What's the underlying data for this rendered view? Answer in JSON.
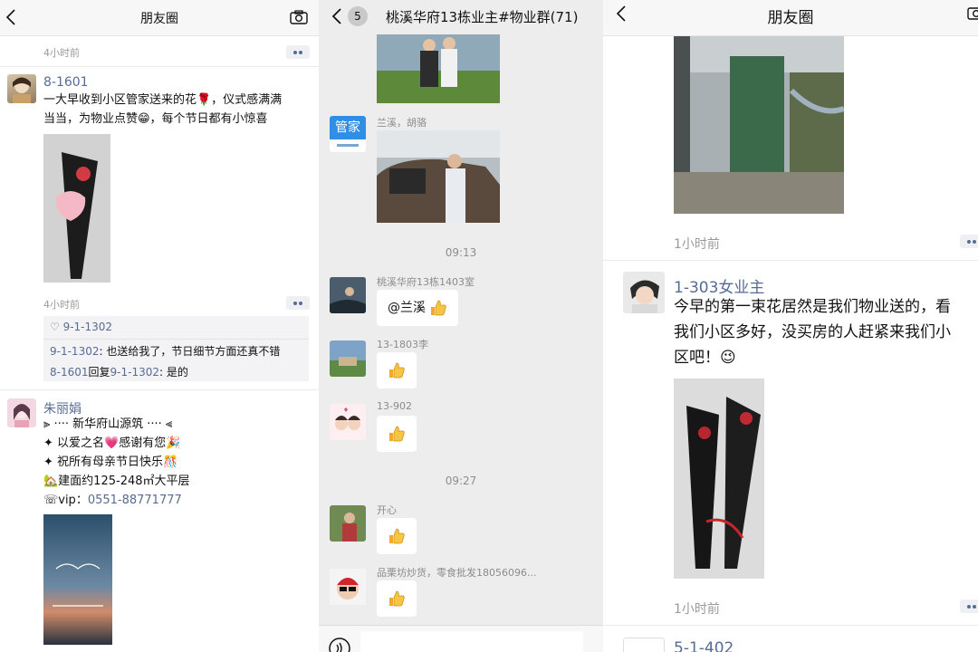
{
  "left": {
    "title": "朋友圈",
    "post0_time": "4小时前",
    "post1": {
      "user": "8-1601",
      "lines": [
        "一大早收到小区管家送来的花🌹，仪式感满满",
        "当当，为物业点赞😁，每个节日都有小惊喜"
      ],
      "time": "4小时前",
      "like": "♡ 9-1-1302",
      "comment1_name": "9-1-1302",
      "comment1_text": ": 也送给我了，节日细节方面还真不错",
      "comment2_name": "8-1601",
      "comment2_mid": "回复",
      "comment2_target": "9-1-1302",
      "comment2_text": ": 是的"
    },
    "post2": {
      "user": "朱丽娟",
      "lines": [
        "⫸ ···· 新华府山源筑 ···· ⫷",
        "✦ 以爱之名💗感谢有您🎉",
        "✦ 祝所有母亲节日快乐🎊",
        "🏡建面约125-248㎡大平层"
      ],
      "phone_label": "☏vip：",
      "phone": "0551-88771777"
    }
  },
  "middle": {
    "back_count": "5",
    "title": "桃溪华府13栋业主#物业群(71)",
    "avatar_guanjia": "管家",
    "sender1": "兰溪，胡骆",
    "time1": "09:13",
    "sender2": "桃溪华府13栋1403室",
    "msg2": "@兰溪",
    "sender3": "13-1803李",
    "sender4": "13-902",
    "time2": "09:27",
    "sender5": "开心",
    "sender6": "品栗坊炒货，零食批发18056096..."
  },
  "right": {
    "title": "朋友圈",
    "time1": "1小时前",
    "post": {
      "user": "1-303女业主",
      "lines": [
        "今早的第一束花居然是我们物业送的，看",
        "我们小区多好，没买房的人赶紧来我们小",
        "区吧！😉"
      ],
      "time": "1小时前"
    },
    "next_user": "5-1-402"
  },
  "colors": {
    "link_blue": "#576b95",
    "chat_bg": "#ededed",
    "bubble_white": "#ffffff"
  }
}
